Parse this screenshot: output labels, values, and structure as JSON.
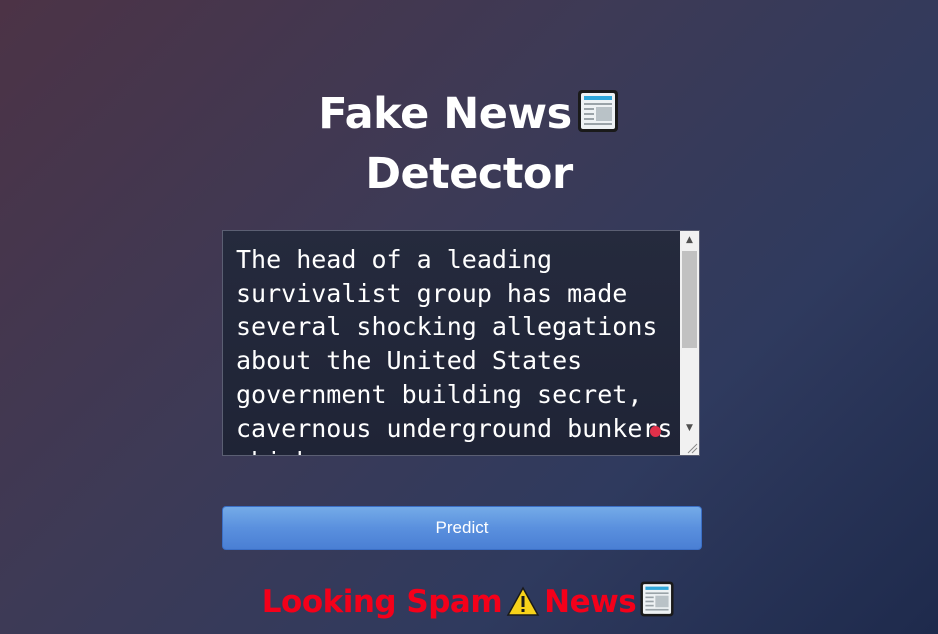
{
  "title": {
    "line1": "Fake News",
    "line2": "Detector",
    "icon": "newspaper-icon"
  },
  "input": {
    "value": "The head of a leading survivalist group has made several shocking allegations about the United States government building secret, cavernous underground bunkers which"
  },
  "predict_button": {
    "label": "Predict"
  },
  "result": {
    "part1": "Looking Spam",
    "part2": "News",
    "warning_icon": "warning-icon",
    "news_icon": "newspaper-icon",
    "color": "#f4001a"
  },
  "colors": {
    "button_top": "#74abe8",
    "button_bottom": "#4a7fd4",
    "background_start": "#4c3346",
    "background_end": "#1e2a4c"
  }
}
